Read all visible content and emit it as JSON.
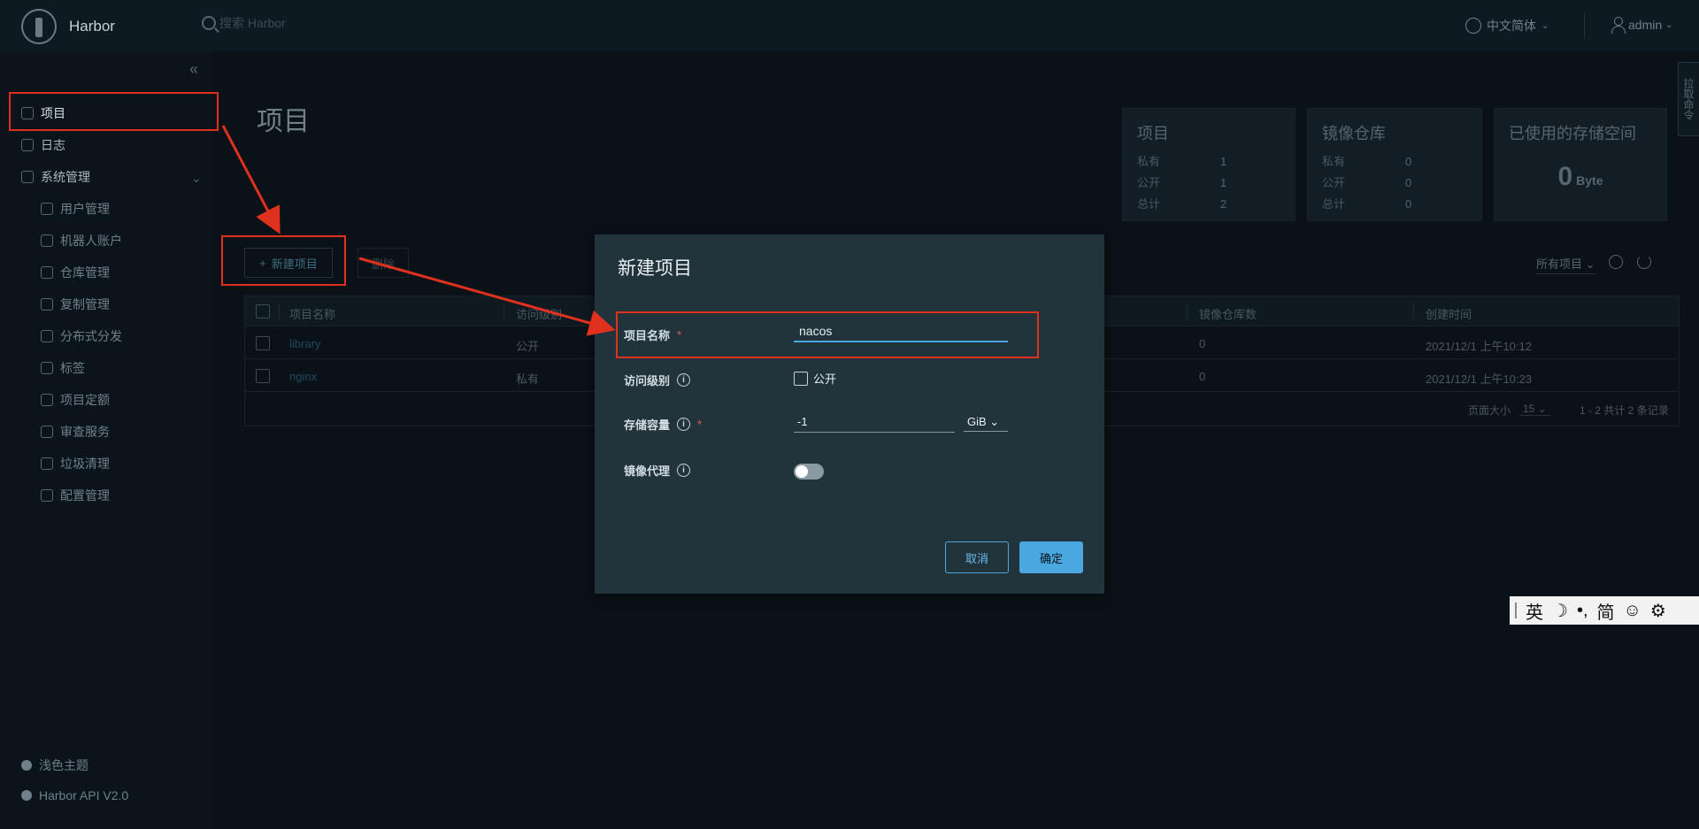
{
  "header": {
    "brand": "Harbor",
    "search_placeholder": "搜索 Harbor",
    "language": "中文简体",
    "user": "admin"
  },
  "sidebar": {
    "items": [
      {
        "label": "项目",
        "active": true
      },
      {
        "label": "日志"
      },
      {
        "label": "系统管理"
      }
    ],
    "sub_items": [
      "用户管理",
      "机器人账户",
      "仓库管理",
      "复制管理",
      "分布式分发",
      "标签",
      "项目定额",
      "审查服务",
      "垃圾清理",
      "配置管理"
    ],
    "footer": {
      "theme": "浅色主题",
      "api": "Harbor API V2.0"
    }
  },
  "page": {
    "title": "项目",
    "cards": {
      "projects": {
        "title": "项目",
        "rows": [
          {
            "label": "私有",
            "value": "1"
          },
          {
            "label": "公开",
            "value": "1"
          },
          {
            "label": "总计",
            "value": "2"
          }
        ]
      },
      "repos": {
        "title": "镜像仓库",
        "rows": [
          {
            "label": "私有",
            "value": "0"
          },
          {
            "label": "公开",
            "value": "0"
          },
          {
            "label": "总计",
            "value": "0"
          }
        ]
      },
      "storage": {
        "title": "已使用的存储空间",
        "value": "0",
        "unit": "Byte"
      }
    },
    "new_project_button": "新建项目",
    "delete_button": "删除",
    "filter": "所有项目",
    "table": {
      "columns": [
        "项目名称",
        "访问级别",
        "镜像仓库数",
        "创建时间"
      ],
      "rows": [
        {
          "name": "library",
          "access": "公开",
          "repos": "0",
          "created": "2021/12/1 上午10:12"
        },
        {
          "name": "nginx",
          "access": "私有",
          "repos": "0",
          "created": "2021/12/1 上午10:23"
        }
      ],
      "page_size_label": "页面大小",
      "page_size": "15",
      "summary": "1 - 2 共计 2 条记录"
    }
  },
  "modal": {
    "title": "新建项目",
    "project_name_label": "项目名称",
    "project_name_value": "nacos",
    "access_label": "访问级别",
    "public_label": "公开",
    "storage_label": "存储容量",
    "storage_value": "-1",
    "storage_unit": "GiB",
    "proxy_label": "镜像代理",
    "cancel": "取消",
    "ok": "确定"
  },
  "side_tab": "拉取命令",
  "ime": {
    "lang": "英",
    "mode": "简"
  },
  "colors": {
    "accent": "#4aa7e0",
    "annotation": "#e0311f",
    "modal_bg": "#21333b"
  }
}
